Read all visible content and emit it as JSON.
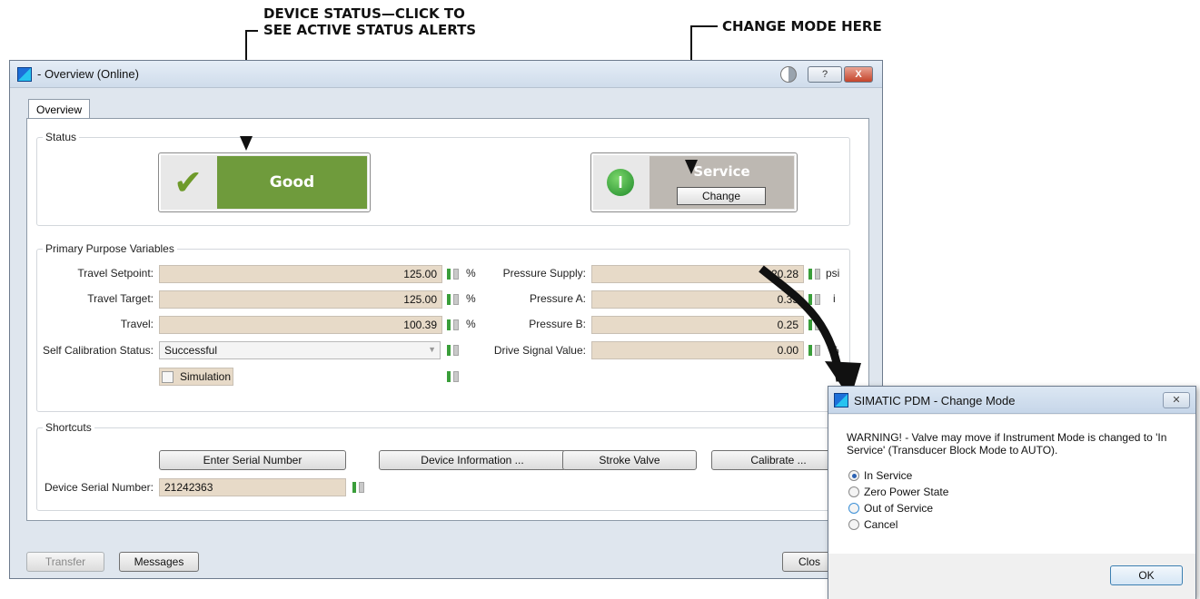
{
  "callouts": {
    "device_status_line1": "DEVICE STATUS—CLICK TO",
    "device_status_line2": "SEE ACTIVE STATUS ALERTS",
    "change_mode": "CHANGE MODE HERE"
  },
  "window": {
    "title": "- Overview (Online)",
    "help_label": "?",
    "close_label": "X"
  },
  "tabs": [
    {
      "label": "Overview"
    }
  ],
  "status": {
    "legend": "Status",
    "device_status": "Good",
    "mode_status": "Service",
    "change_label": "Change",
    "colors": {
      "good": "#6f9b3c",
      "service": "#bdb8b2"
    }
  },
  "primary": {
    "legend": "Primary Purpose Variables",
    "left": [
      {
        "label": "Travel Setpoint:",
        "value": "125.00",
        "unit": "%"
      },
      {
        "label": "Travel Target:",
        "value": "125.00",
        "unit": "%"
      },
      {
        "label": "Travel:",
        "value": "100.39",
        "unit": "%"
      },
      {
        "label": "Self Calibration Status:",
        "value": "Successful",
        "unit": ""
      }
    ],
    "right": [
      {
        "label": "Pressure Supply:",
        "value": "20.28",
        "unit": "psi"
      },
      {
        "label": "Pressure A:",
        "value": "0.35",
        "unit": "i"
      },
      {
        "label": "Pressure B:",
        "value": "0.25",
        "unit": ""
      },
      {
        "label": "Drive Signal Value:",
        "value": "0.00",
        "unit": "%"
      }
    ],
    "simulation_label": "Simulation"
  },
  "shortcuts": {
    "legend": "Shortcuts",
    "buttons": [
      "Enter Serial Number",
      "Device Information ...",
      "Stroke Valve",
      "Calibrate ..."
    ],
    "serial_label": "Device Serial Number:",
    "serial_value": "21242363"
  },
  "footer": {
    "transfer": "Transfer",
    "messages": "Messages",
    "close": "Clos"
  },
  "dialog": {
    "title": "SIMATIC PDM - Change Mode",
    "close_label": "✕",
    "warning": "WARNING! - Valve may move if Instrument Mode is changed to 'In Service' (Transducer Block Mode to AUTO).",
    "options": [
      {
        "label": "In Service",
        "selected": true
      },
      {
        "label": "Zero Power State",
        "selected": false
      },
      {
        "label": "Out of Service",
        "selected": false
      },
      {
        "label": "Cancel",
        "selected": false
      }
    ],
    "ok": "OK"
  }
}
